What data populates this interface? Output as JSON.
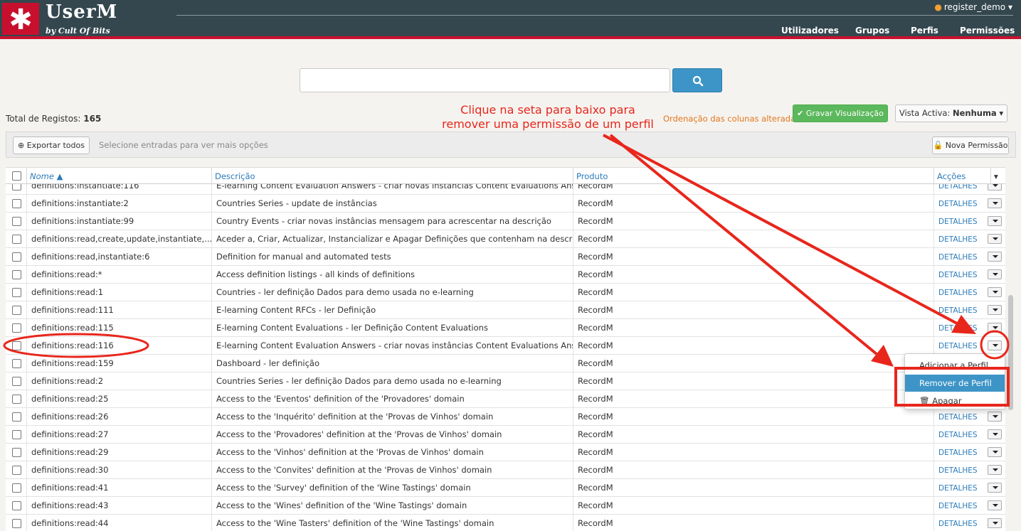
{
  "app": {
    "logo_glyph": "✱",
    "title": "UserM",
    "subtitle": "by Cult Of Bits",
    "user": "register_demo",
    "nav": [
      "Utilizadores",
      "Grupos",
      "Perfis",
      "Permissões"
    ]
  },
  "search": {
    "placeholder": "",
    "icon": "search-icon"
  },
  "summary": {
    "total_label": "Total de Registos:",
    "total_value": "165",
    "order_note": "Ordenação das colunas alterada",
    "save_view": "✔ Gravar Visualização",
    "vista_label": "Vista Activa:",
    "vista_value": "Nenhuma"
  },
  "annotation": {
    "line1": "Clique na seta para baixo para",
    "line2": "remover uma permissão de um perfil",
    "color": "#e8261c"
  },
  "toolbar": {
    "export_all": "Exportar todos",
    "select_hint": "Selecione entradas para ver mais opções",
    "new_permission": "Nova Permissão"
  },
  "table": {
    "columns": [
      "Nome ▲",
      "Descrição",
      "Produto",
      "Acções"
    ],
    "action_link": "DETALHES",
    "rows": [
      {
        "nome": "definitions:instantiate:116",
        "desc": "E-learning Content Evaluation Answers - criar novas instâncias Content Evaluations Answers",
        "prod": "RecordM"
      },
      {
        "nome": "definitions:instantiate:2",
        "desc": "Countries Series - update de instâncias",
        "prod": "RecordM"
      },
      {
        "nome": "definitions:instantiate:99",
        "desc": "Country Events - criar novas instâncias mensagem para acrescentar na descrição",
        "prod": "RecordM"
      },
      {
        "nome": "definitions:read,create,update,instantiate,...",
        "desc": "Aceder a, Criar, Actualizar, Instancializar e Apagar Definições que contenham na descrição...",
        "prod": "RecordM"
      },
      {
        "nome": "definitions:read,instantiate:6",
        "desc": "Definition for manual and automated tests",
        "prod": "RecordM"
      },
      {
        "nome": "definitions:read:*",
        "desc": "Access definition listings - all kinds of definitions",
        "prod": "RecordM"
      },
      {
        "nome": "definitions:read:1",
        "desc": "Countries - ler definição Dados para demo usada no e-learning",
        "prod": "RecordM"
      },
      {
        "nome": "definitions:read:111",
        "desc": "E-learning Content RFCs - ler Definição",
        "prod": "RecordM"
      },
      {
        "nome": "definitions:read:115",
        "desc": "E-learning Content Evaluations - ler Definição Content Evaluations",
        "prod": "RecordM"
      },
      {
        "nome": "definitions:read:116",
        "desc": "E-learning Content Evaluation Answers - criar novas instâncias Content Evaluations Answers",
        "prod": "RecordM"
      },
      {
        "nome": "definitions:read:159",
        "desc": "Dashboard - ler definição",
        "prod": "RecordM"
      },
      {
        "nome": "definitions:read:2",
        "desc": "Countries Series - ler definição Dados para demo usada no e-learning",
        "prod": "RecordM"
      },
      {
        "nome": "definitions:read:25",
        "desc": "Access to the 'Eventos' definition of the 'Provadores' domain",
        "prod": "RecordM"
      },
      {
        "nome": "definitions:read:26",
        "desc": "Access to the 'Inquérito' definition at the 'Provas de Vinhos' domain",
        "prod": "RecordM"
      },
      {
        "nome": "definitions:read:27",
        "desc": "Access to the 'Provadores' definition at the 'Provas de Vinhos' domain",
        "prod": "RecordM"
      },
      {
        "nome": "definitions:read:29",
        "desc": "Access to the 'Vinhos' definition at the 'Provas de Vinhos' domain",
        "prod": "RecordM"
      },
      {
        "nome": "definitions:read:30",
        "desc": "Access to the 'Convites' definition at the 'Provas de Vinhos' domain",
        "prod": "RecordM"
      },
      {
        "nome": "definitions:read:41",
        "desc": "Access to the 'Survey' definition of the 'Wine Tastings' domain",
        "prod": "RecordM"
      },
      {
        "nome": "definitions:read:43",
        "desc": "Access to the 'Wines' definition of the 'Wine Tastings' domain",
        "prod": "RecordM"
      },
      {
        "nome": "definitions:read:44",
        "desc": "Access to the 'Wine Tasters' definition of the 'Wine Tastings' domain",
        "prod": "RecordM"
      }
    ]
  },
  "dropdown": {
    "items": [
      "Adicionar a Perfil",
      "Remover de Perfil",
      "🗑 Apagar"
    ]
  }
}
